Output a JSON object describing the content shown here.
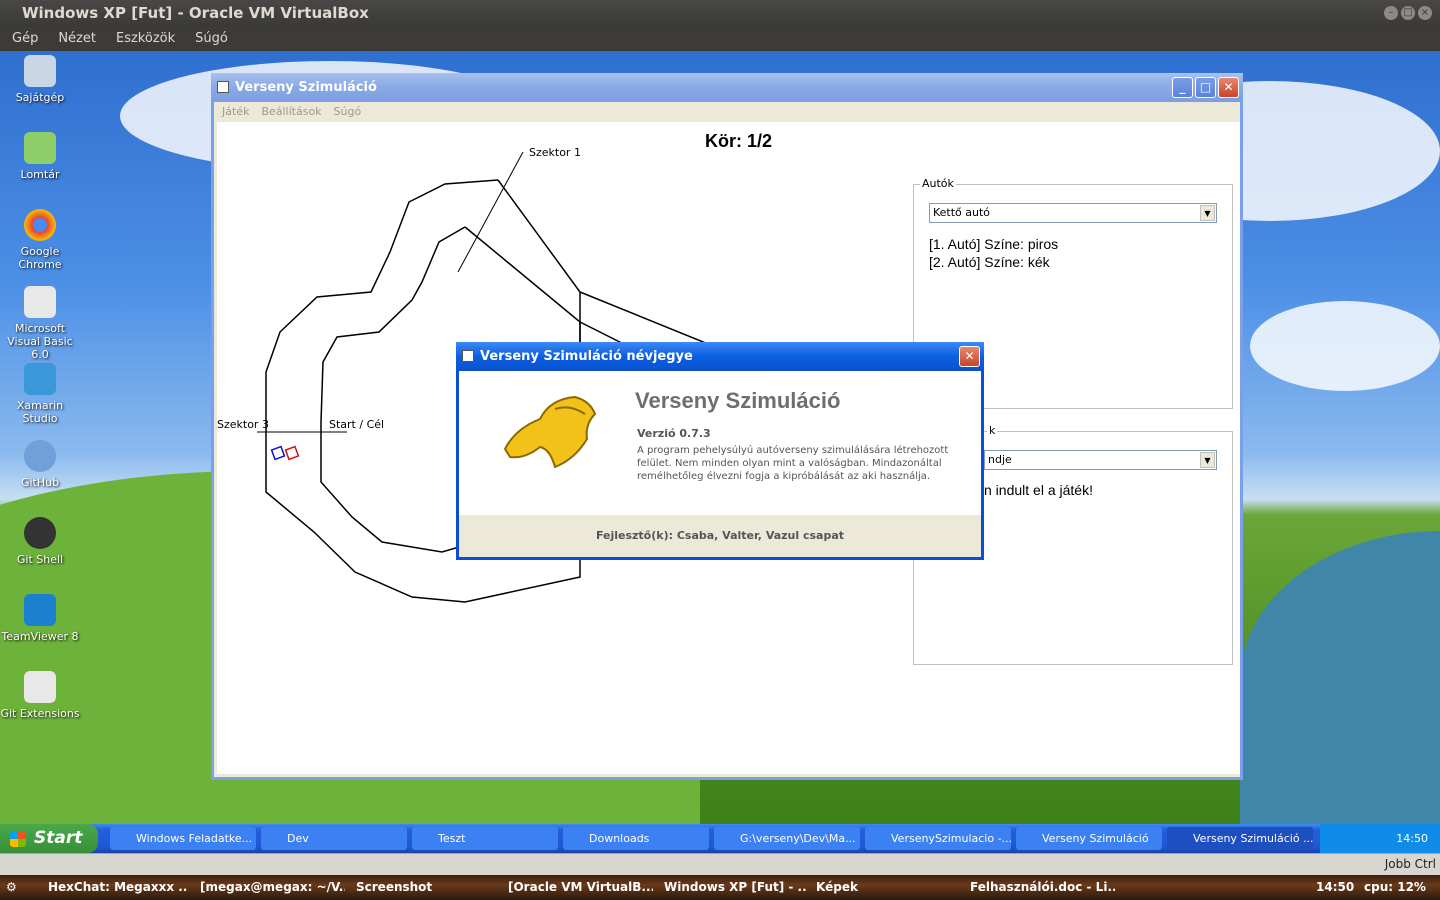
{
  "host_window": {
    "title": "Windows XP [Fut] - Oracle VM VirtualBox",
    "menu": [
      "Gép",
      "Nézet",
      "Eszközök",
      "Súgó"
    ]
  },
  "desktop_icons": [
    {
      "label": "Sajátgép",
      "icon": "my-computer-icon"
    },
    {
      "label": "Lomtár",
      "icon": "recycle-bin-icon"
    },
    {
      "label": "Google Chrome",
      "icon": "chrome-icon"
    },
    {
      "label": "Microsoft Visual Basic 6.0",
      "icon": "visual-basic-icon"
    },
    {
      "label": "Xamarin Studio",
      "icon": "xamarin-icon"
    },
    {
      "label": "GitHub",
      "icon": "github-icon"
    },
    {
      "label": "Git Shell",
      "icon": "git-shell-icon"
    },
    {
      "label": "TeamViewer 8",
      "icon": "teamviewer-icon"
    },
    {
      "label": "Git Extensions",
      "icon": "git-extensions-icon"
    }
  ],
  "app": {
    "title": "Verseny Szimuláció",
    "menu": [
      "Játék",
      "Beállítások",
      "Súgó"
    ],
    "lap": "Kör: 1/2",
    "track_labels": {
      "sector1": "Szektor 1",
      "sector3": "Szektor 3",
      "start": "Start / Cél"
    },
    "cars_group": {
      "label": "Autók",
      "selected": "Kettő autó",
      "lines": [
        "[1. Autó] Színe: piros",
        "[2. Autó] Színe: kék"
      ]
    },
    "results_group": {
      "label_visible": "k",
      "selected_visible": "ndje",
      "text_visible": "n indult el a játék!"
    }
  },
  "about_dialog": {
    "title": "Verseny Szimuláció névjegye",
    "app_name": "Verseny Szimuláció",
    "version": "Verzió 0.7.3",
    "description": "A program pehelysúlyú autóverseny szimulálására létrehozott felület. Nem minden olyan mint a valóságban. Mindazonáltal remélhetőleg élvezni fogja a kipróbálását az aki használja.",
    "developers": "Fejlesztő(k): Csaba, Valter, Vazul csapat"
  },
  "taskbar": {
    "start_label": "Start",
    "items": [
      "Windows Feladatke...",
      "Dev",
      "Teszt",
      "Downloads",
      "G:\\verseny\\Dev\\Ma...",
      "VersenySzimulacio -...",
      "Verseny Szimuláció",
      "Verseny Szimuláció ..."
    ],
    "clock": "14:50"
  },
  "host_status": {
    "host_key": "Jobb Ctrl"
  },
  "host_panel": {
    "items": [
      "HexChat: Megaxxx ...",
      "[megax@megax: ~/V...",
      "Screenshot",
      "[Oracle VM VirtualB...",
      "Windows XP [Fut] - ...",
      "Képek",
      "Felhasználói.doc - Li..."
    ],
    "clock": "14:50",
    "cpu": "cpu:  12%"
  },
  "colors": {
    "xp_blue": "#0a52d0",
    "accent_red": "#e8876c",
    "start_green": "#389038"
  }
}
